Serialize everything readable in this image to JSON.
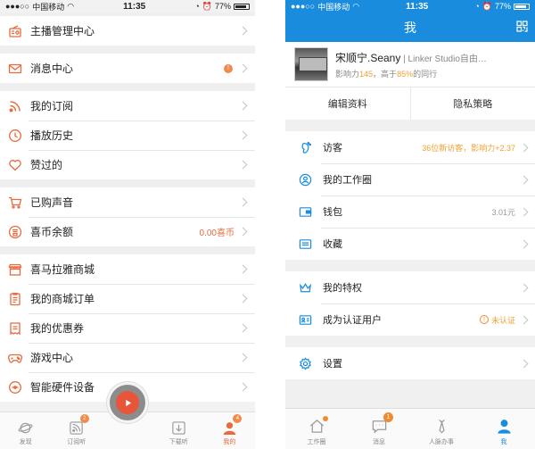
{
  "left_phone": {
    "status": {
      "carrier": "中国移动",
      "time": "11:35",
      "battery": "77%"
    },
    "rows": {
      "host_center": "主播管理中心",
      "messages": "消息中心",
      "messages_badge": "!",
      "subscriptions": "我的订阅",
      "history": "播放历史",
      "liked": "赞过的",
      "purchased": "已购声音",
      "xi_balance": "喜币余额",
      "xi_balance_value": "0.00喜币",
      "store": "喜马拉雅商城",
      "store_orders": "我的商城订单",
      "coupons": "我的优惠券",
      "game_center": "游戏中心",
      "smart_hardware": "智能硬件设备"
    },
    "tabs": {
      "discover": "发现",
      "subscribe": "订阅听",
      "subscribe_badge": "2",
      "download": "下载听",
      "mine": "我的",
      "mine_badge": "4"
    },
    "accent": "#e86a3e"
  },
  "right_phone": {
    "status": {
      "carrier": "中国移动",
      "time": "11:35",
      "battery": "77%"
    },
    "title": "我",
    "profile": {
      "name": "宋顺宁.Seany",
      "company": " | Linker Studio自由…",
      "influence_label": "影响力",
      "influence_value": "145",
      "higher_than_label": "，高于",
      "higher_than_value": "85%",
      "peers_label": "的同行"
    },
    "actions": {
      "edit": "编辑资料",
      "privacy": "隐私策略"
    },
    "rows": {
      "visitors": "访客",
      "visitors_value": "36位新访客，影响力+2.37",
      "circle": "我的工作圈",
      "wallet": "钱包",
      "wallet_value": "3.01元",
      "favorites": "收藏",
      "privileges": "我的特权",
      "verify": "成为认证用户",
      "verify_value": "未认证",
      "settings": "设置"
    },
    "tabs": {
      "workcircle": "工作圈",
      "messages": "消息",
      "messages_badge": "1",
      "network": "人脉办事",
      "me": "我"
    },
    "accent": "#1a8cde"
  }
}
